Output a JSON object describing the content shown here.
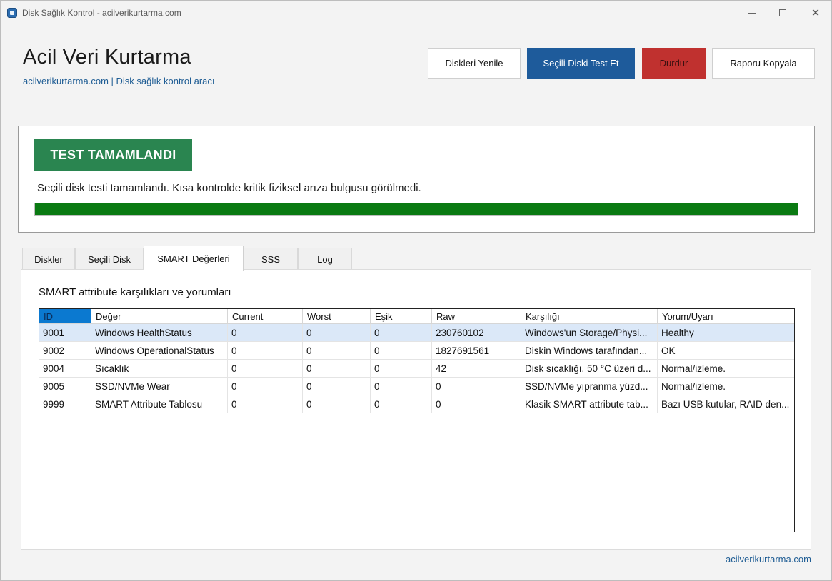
{
  "window": {
    "title": "Disk Sağlık Kontrol - acilverikurtarma.com"
  },
  "header": {
    "title": "Acil Veri Kurtarma",
    "subtitle": "acilverikurtarma.com | Disk sağlık kontrol aracı"
  },
  "toolbar": {
    "refresh_label": "Diskleri Yenile",
    "test_label": "Seçili Diski Test Et",
    "stop_label": "Durdur",
    "copy_label": "Raporu Kopyala"
  },
  "status": {
    "badge": "TEST TAMAMLANDI",
    "message": "Seçili disk testi tamamlandı. Kısa kontrolde kritik fiziksel arıza bulgusu görülmedi.",
    "progress_percent": 100,
    "badge_color": "#2a8550",
    "progress_color": "#0a7a12"
  },
  "tabs": [
    {
      "label": "Diskler",
      "active": false
    },
    {
      "label": "Seçili Disk",
      "active": false
    },
    {
      "label": "SMART Değerleri",
      "active": true
    },
    {
      "label": "SSS",
      "active": false
    },
    {
      "label": "Log",
      "active": false
    }
  ],
  "smart": {
    "section_title": "SMART attribute karşılıkları ve yorumları",
    "columns": [
      "ID",
      "Değer",
      "Current",
      "Worst",
      "Eşik",
      "Raw",
      "Karşılığı",
      "Yorum/Uyarı"
    ],
    "rows": [
      [
        "9001",
        "Windows HealthStatus",
        "0",
        "0",
        "0",
        "230760102",
        "Windows'un Storage/Physi...",
        "Healthy"
      ],
      [
        "9002",
        "Windows OperationalStatus",
        "0",
        "0",
        "0",
        "1827691561",
        "Diskin Windows tarafından...",
        "OK"
      ],
      [
        "9004",
        "Sıcaklık",
        "0",
        "0",
        "0",
        "42",
        "Disk sıcaklığı. 50 °C üzeri d...",
        "Normal/izleme."
      ],
      [
        "9005",
        "SSD/NVMe Wear",
        "0",
        "0",
        "0",
        "0",
        "SSD/NVMe yıpranma yüzd...",
        "Normal/izleme."
      ],
      [
        "9999",
        "SMART Attribute Tablosu",
        "0",
        "0",
        "0",
        "0",
        "Klasik SMART attribute tab...",
        "Bazı USB kutular, RAID den..."
      ]
    ],
    "selected_row": 0
  },
  "footer": {
    "link": "acilverikurtarma.com"
  }
}
